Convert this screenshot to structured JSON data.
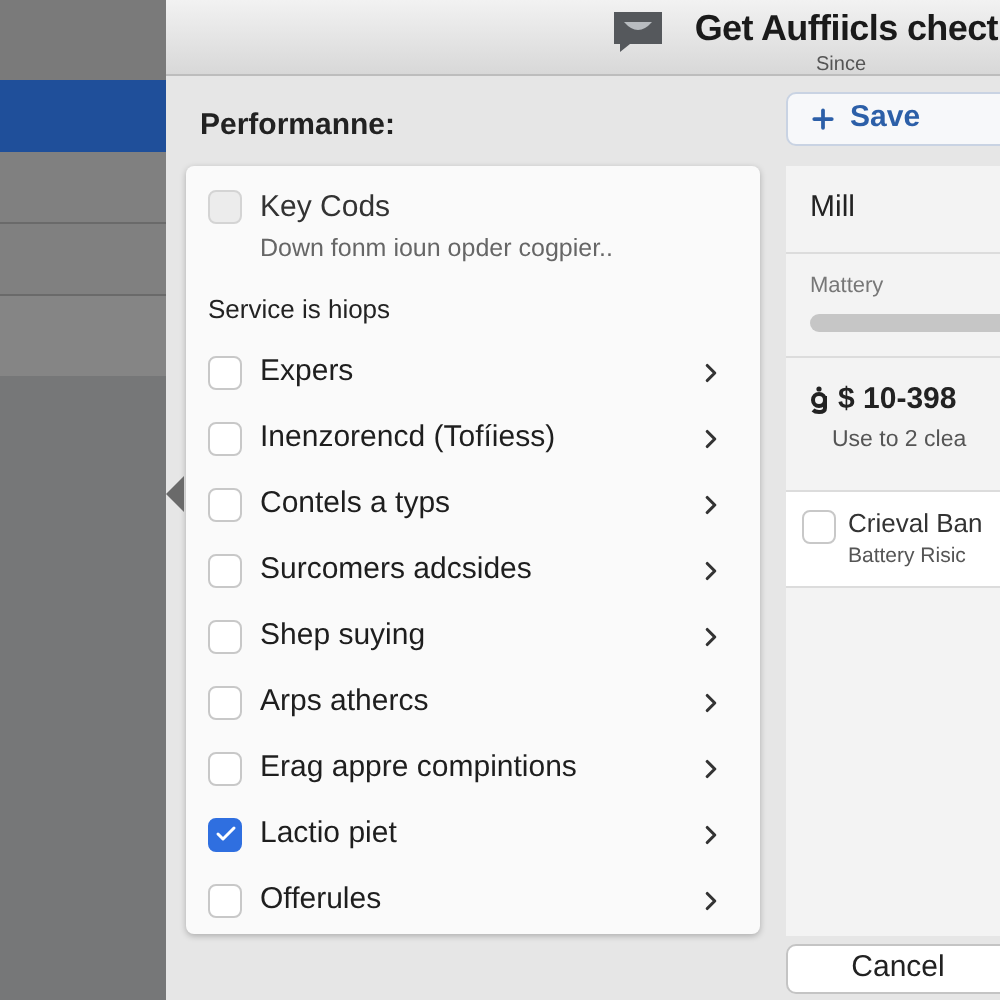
{
  "dialog": {
    "title": "Get Auffiicls chect",
    "subtitle": "Since"
  },
  "section_title": "Performanne:",
  "list": {
    "header": {
      "label": "Key Cods",
      "description": "Down fonm ioun opder cogpier..",
      "checked": false,
      "disabled": true
    },
    "group_label": "Service is hiops",
    "items": [
      {
        "label": "Expers",
        "checked": false
      },
      {
        "label": "Inenzorencd (Tofíiess)",
        "checked": false
      },
      {
        "label": "Contels a typs",
        "checked": false
      },
      {
        "label": "Surcomers adcsides",
        "checked": false
      },
      {
        "label": "Shep suying",
        "checked": false
      },
      {
        "label": "Arps athercs",
        "checked": false
      },
      {
        "label": "Erag appre compintions",
        "checked": false
      },
      {
        "label": "Lactio piet",
        "checked": true
      },
      {
        "label": "Offerules",
        "checked": false
      }
    ]
  },
  "save_button": "Save",
  "side_panel": {
    "title": "Mill",
    "meter_label": "Mattery",
    "price": "$ 10-398",
    "price_note": "Use to 2 clea",
    "option": {
      "label": "Crieval Ban",
      "sublabel": "Battery Risic",
      "checked": false
    }
  },
  "cancel_button": "Cancel"
}
